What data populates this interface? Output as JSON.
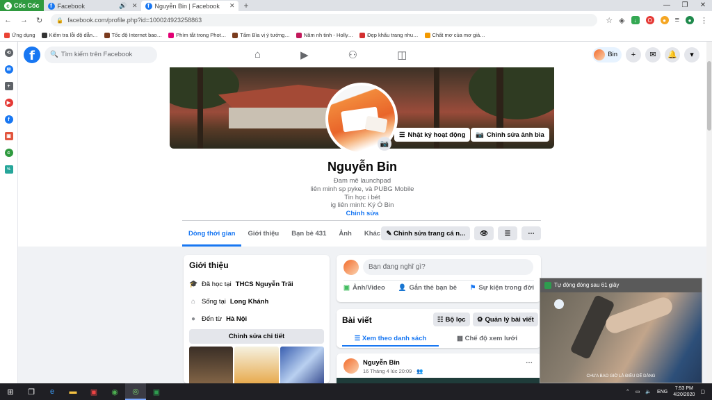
{
  "browser": {
    "brand": "Cốc Cốc",
    "tabs": [
      {
        "title": "Facebook",
        "active": false
      },
      {
        "title": "Nguyễn Bin | Facebook",
        "active": true
      }
    ],
    "url": "facebook.com/profile.php?id=100024923258863",
    "bookmarks": [
      {
        "label": "Ứng dụng",
        "color": "#ea4335"
      },
      {
        "label": "Kiếm tra lỗi độ dẫn…",
        "color": "#333333"
      },
      {
        "label": "Tốc độ Internet bao…",
        "color": "#7a3b1e"
      },
      {
        "label": "Phím tắt trong Phot…",
        "color": "#e20074"
      },
      {
        "label": "Tấm Bìa vị ý tưởng…",
        "color": "#7a3b1e"
      },
      {
        "label": "Nâm nh tinh - Holly…",
        "color": "#c2185b"
      },
      {
        "label": "Đẹp khẩu trang nhu…",
        "color": "#d32f2f"
      },
      {
        "label": "Chất mơ của mơ giả…",
        "color": "#f29900"
      }
    ]
  },
  "facebook": {
    "search_placeholder": "Tìm kiếm trên Facebook",
    "user_short": "Bin",
    "profile": {
      "name": "Nguyễn Bin",
      "bio": [
        "Đam mê launchpad",
        "liên minh sp pyke, và PUBG Mobile",
        "Tin học i bét",
        "ig liên minh: Ký Ó Bin"
      ],
      "edit_bio": "Chỉnh sửa",
      "cover_buttons": {
        "activity_log": "Nhật ký hoạt động",
        "edit_cover": "Chỉnh sửa ảnh bìa"
      }
    },
    "tabs": [
      "Dòng thời gian",
      "Giới thiệu",
      "Bạn bè 431",
      "Ảnh",
      "Khác"
    ],
    "tab_buttons": {
      "edit_profile": "Chỉnh sửa trang cá n..."
    },
    "intro": {
      "title": "Giới thiệu",
      "rows": [
        {
          "prefix": "Đã học tại",
          "value": "THCS Nguyễn Trãi"
        },
        {
          "prefix": "Sống tại",
          "value": "Long Khánh"
        },
        {
          "prefix": "Đến từ",
          "value": "Hà Nội"
        }
      ],
      "edit_details": "Chỉnh sửa chi tiết"
    },
    "composer": {
      "placeholder": "Bạn đang nghĩ gì?",
      "actions": [
        "Ảnh/Video",
        "Gắn thẻ bạn bè",
        "Sự kiện trong đời"
      ]
    },
    "posts": {
      "title": "Bài viết",
      "filter": "Bộ lọc",
      "manage": "Quản lý bài viết",
      "views": [
        "Xem theo danh sách",
        "Chế độ xem lưới"
      ]
    },
    "post": {
      "author": "Nguyễn Bin",
      "date": "16 Tháng 4 lúc 20:09"
    }
  },
  "video_popup": {
    "title": "Tự động đóng sau 61 giây",
    "caption": "CHƯA BAO GIỜ LÀ ĐIỀU DỄ DÀNG"
  },
  "taskbar": {
    "language": "ENG",
    "time": "7:53 PM",
    "date": "4/20/2020"
  },
  "colors": {
    "facebook_blue": "#1877f2",
    "coccoc_green": "#2f9a3f"
  }
}
